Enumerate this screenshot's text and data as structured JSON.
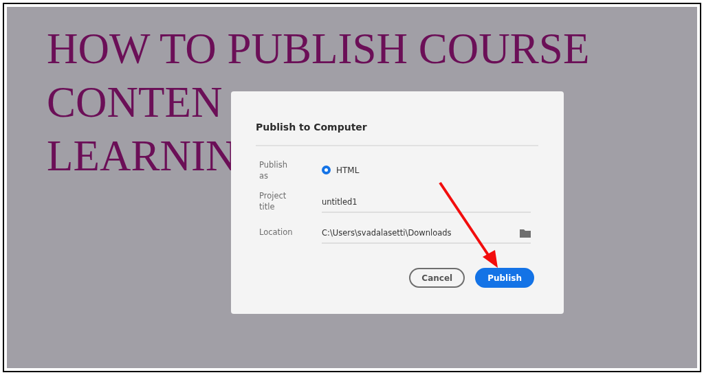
{
  "heading_lines": [
    "HOW TO PUBLISH COURSE",
    "CONTEN",
    "LEARNIN"
  ],
  "dialog": {
    "title": "Publish to Computer",
    "publish_as": {
      "label": "Publish as",
      "options": [
        {
          "label": "HTML",
          "selected": true
        }
      ]
    },
    "project_title": {
      "label": "Project title",
      "value": "untitled1"
    },
    "location": {
      "label": "Location",
      "value": "C:\\Users\\svadalasetti\\Downloads"
    },
    "buttons": [
      {
        "label": "Cancel",
        "kind": "secondary"
      },
      {
        "label": "Publish",
        "kind": "primary"
      }
    ]
  }
}
